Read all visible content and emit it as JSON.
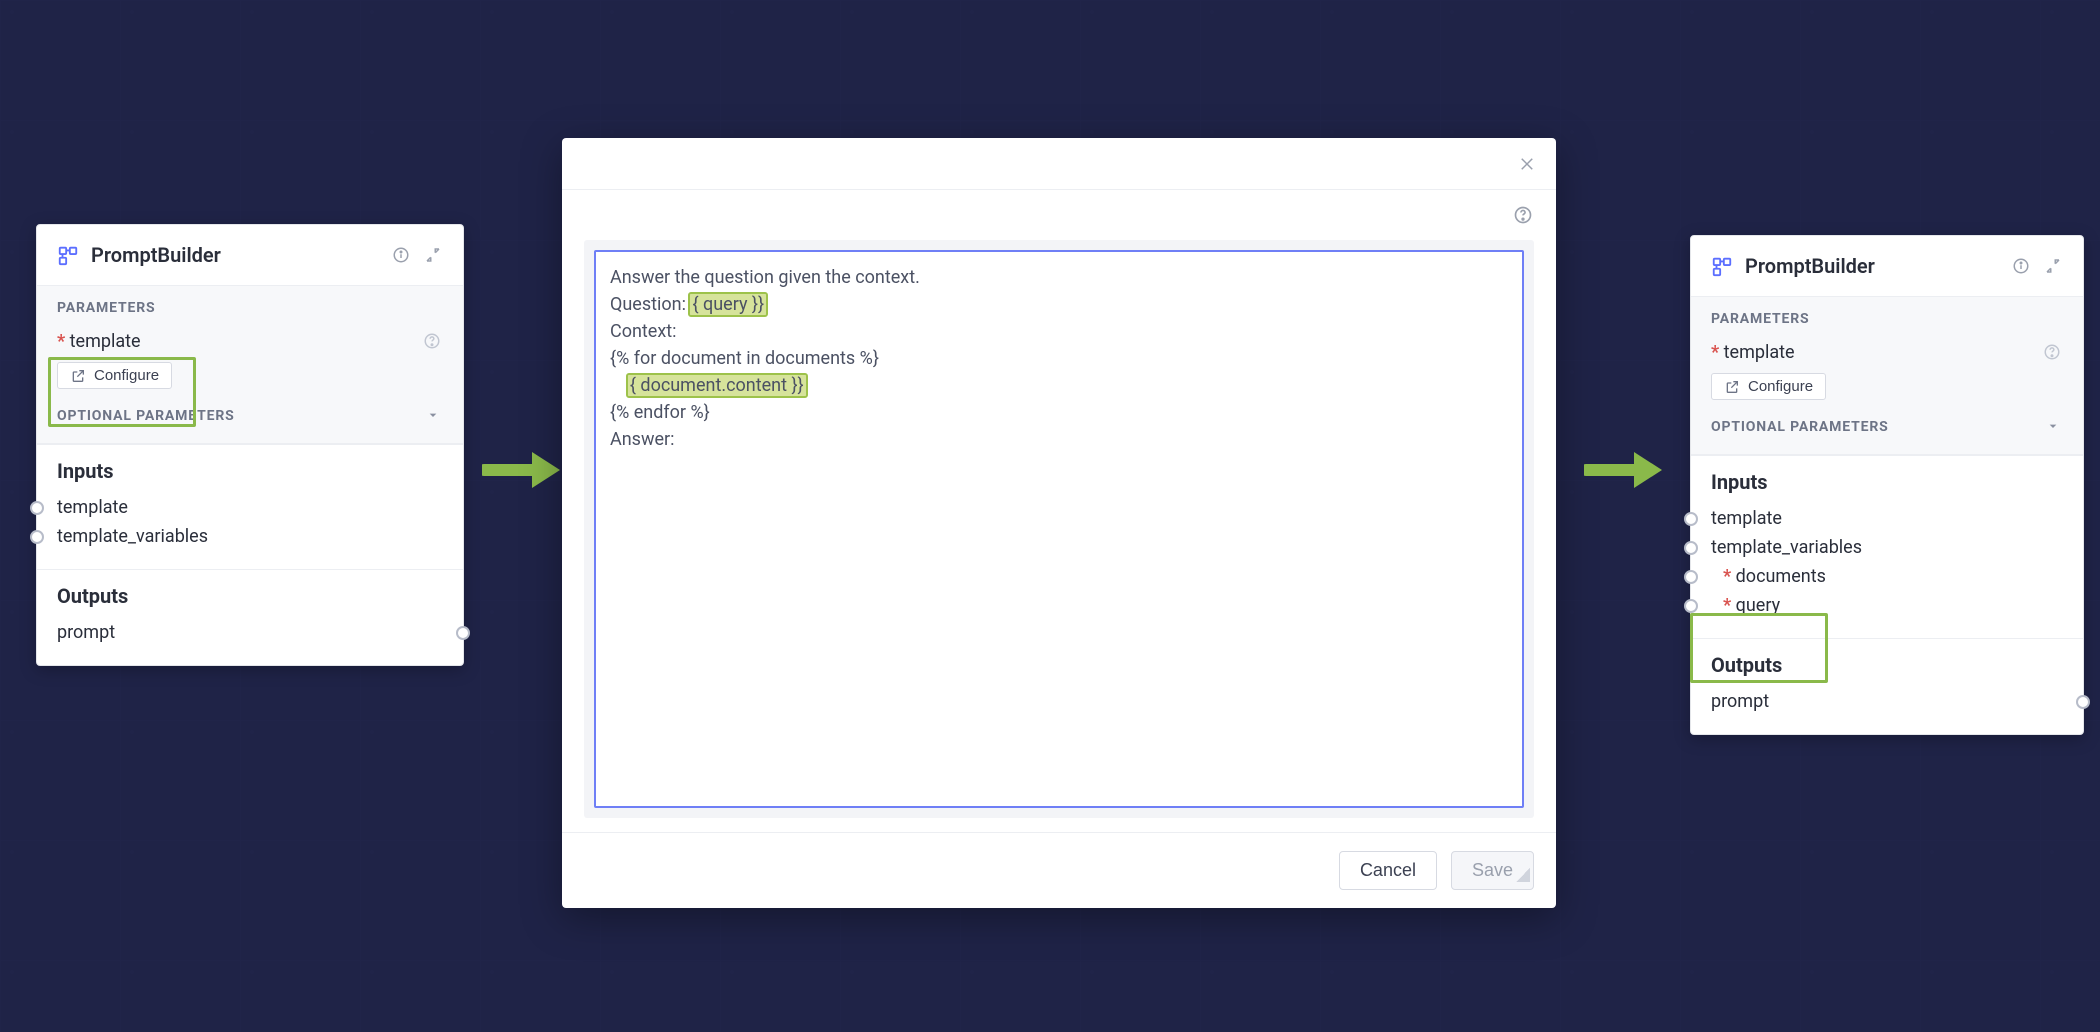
{
  "colors": {
    "accent": "#8ab94a",
    "link": "#5b6eff",
    "required": "#d9534f"
  },
  "left_card": {
    "title": "PromptBuilder",
    "parameters_label": "PARAMETERS",
    "template_label": "template",
    "configure_label": "Configure",
    "optional_label": "OPTIONAL PARAMETERS",
    "inputs_title": "Inputs",
    "inputs": [
      "template",
      "template_variables"
    ],
    "outputs_title": "Outputs",
    "outputs": [
      "prompt"
    ]
  },
  "right_card": {
    "title": "PromptBuilder",
    "parameters_label": "PARAMETERS",
    "template_label": "template",
    "configure_label": "Configure",
    "optional_label": "OPTIONAL PARAMETERS",
    "inputs_title": "Inputs",
    "inputs_plain": [
      "template",
      "template_variables"
    ],
    "inputs_required": [
      "documents",
      "query"
    ],
    "outputs_title": "Outputs",
    "outputs": [
      "prompt"
    ]
  },
  "modal": {
    "lines": {
      "l1": "Answer the question given the context.",
      "l2a": "Question: ",
      "l2b": "{ query }}",
      "l3": "Context:",
      "l4": "{% for document in documents %}",
      "l5a": "    ",
      "l5b": "{ document.content }}",
      "l6": "{% endfor %}",
      "l7": "Answer:"
    },
    "cancel": "Cancel",
    "save": "Save"
  }
}
